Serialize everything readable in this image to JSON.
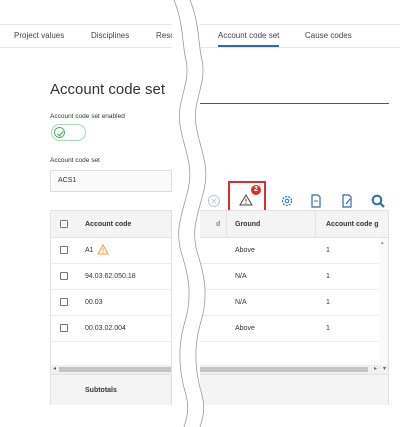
{
  "left_tabs": [
    "Project values",
    "Disciplines",
    "Reso"
  ],
  "right_tabs": {
    "active": "Account code set",
    "other": "Cause codes"
  },
  "page_title": "Account code set",
  "enabled_label": "Account code set enabled",
  "enabled_state": true,
  "account_code_set_label": "Account code set",
  "account_code_set_value": "ACS1",
  "toolbar": {
    "warning_count": "2",
    "icons": [
      "clear-icon",
      "warning-icon",
      "settings-icon",
      "export-icon",
      "edit-icon",
      "search-icon"
    ]
  },
  "table": {
    "columns_left": [
      "Account code"
    ],
    "columns_right": [
      "Ground",
      "Account code g"
    ],
    "partial_right_header": "d",
    "rows": [
      {
        "account_code": "A1",
        "warning": true,
        "ground": "Above",
        "group": "1"
      },
      {
        "account_code": "94.03.62.050.18",
        "warning": false,
        "ground": "N/A",
        "group": "1"
      },
      {
        "account_code": "00.03",
        "warning": false,
        "ground": "N/A",
        "group": "1"
      },
      {
        "account_code": "00.03.02.004",
        "warning": false,
        "ground": "Above",
        "group": "1"
      }
    ],
    "subtotals_label": "Subtotals"
  },
  "colors": {
    "accent": "#2b6cb0",
    "warning": "#d9302b",
    "toggle": "#4fae6a",
    "warn_triangle": "#f0a030"
  }
}
